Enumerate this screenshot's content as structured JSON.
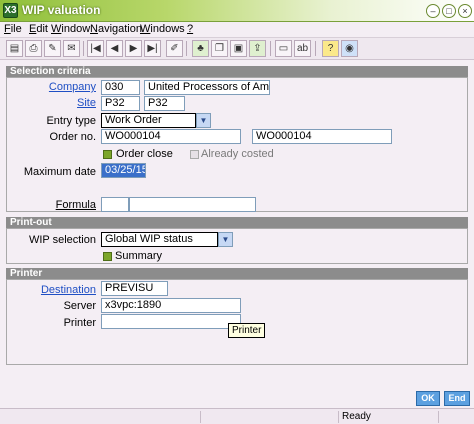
{
  "window": {
    "title": "WIP valuation",
    "app_icon": "X3"
  },
  "menu": [
    {
      "label": "File",
      "key": "F",
      "rest": "ile"
    },
    {
      "label": "Edit",
      "key": "E",
      "rest": "dit"
    },
    {
      "label": "Window",
      "key": "W",
      "rest": "indow"
    },
    {
      "label": "Navigation",
      "key": "N",
      "rest": "avigation"
    },
    {
      "label": "Windows",
      "key": "W",
      "rest": "indows"
    },
    {
      "label": "?",
      "key": "?",
      "rest": ""
    }
  ],
  "toolbar": {
    "icons": [
      "save-icon",
      "print-icon",
      "delete-icon",
      "attach-icon",
      "first-icon",
      "prev-icon",
      "next-icon",
      "last-icon",
      "edit-icon",
      "help-icon",
      "tree-icon",
      "copy-icon",
      "window-icon",
      "export-icon",
      "text-icon",
      "field-icon",
      "ref-icon",
      "web-icon"
    ]
  },
  "selection": {
    "header": "Selection criteria",
    "company_label": "Company",
    "company_code": "030",
    "company_name": "United Processors of America",
    "site_label": "Site",
    "site_code": "P32",
    "site_name": "P32",
    "entry_type_label": "Entry type",
    "entry_type_value": "Work Order",
    "order_no_label": "Order no.",
    "order_from": "WO000104",
    "order_to": "WO000104",
    "order_close_label": "Order close",
    "already_costed_label": "Already costed",
    "max_date_label": "Maximum date",
    "max_date_value": "03/25/15",
    "formula_label": "Formula",
    "formula_value": ""
  },
  "printout": {
    "header": "Print-out",
    "wip_selection_label": "WIP selection",
    "wip_selection_value": "Global WIP status",
    "summary_label": "Summary"
  },
  "printer": {
    "header": "Printer",
    "destination_label": "Destination",
    "destination_value": "PREVISU",
    "server_label": "Server",
    "server_value": "x3vpc:1890",
    "printer_label": "Printer",
    "printer_value": "",
    "tooltip": "Printer"
  },
  "actions": {
    "ok": "OK",
    "end": "End"
  },
  "status": {
    "ready": "Ready"
  }
}
